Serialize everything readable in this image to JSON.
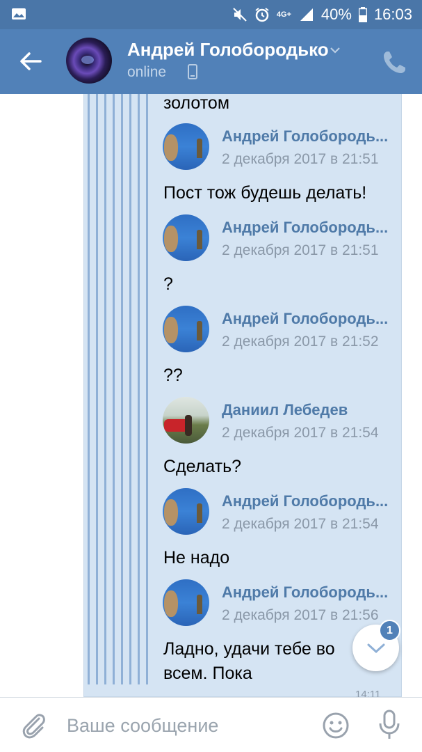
{
  "status_bar": {
    "network": "4G+",
    "battery": "40%",
    "time": "16:03",
    "icons": [
      "image-icon",
      "mute-icon",
      "alarm-icon",
      "network-icon",
      "signal-icon",
      "battery-icon"
    ]
  },
  "header": {
    "title": "Андрей Голобородько",
    "status": "online",
    "icons": [
      "back-arrow-icon",
      "chevron-down-icon",
      "mobile-device-icon",
      "phone-icon"
    ]
  },
  "forwarded": {
    "top_text": "золотом",
    "messages": [
      {
        "sender": "Андрей Голобородь...",
        "date": "2 декабря 2017 в 21:51",
        "text": "Пост тож будешь делать!"
      },
      {
        "sender": "Андрей Голобородь...",
        "date": "2 декабря 2017 в 21:51",
        "text": "?"
      },
      {
        "sender": "Андрей Голобородь...",
        "date": "2 декабря 2017 в 21:52",
        "text": "??"
      },
      {
        "sender": "Даниил Лебедев",
        "date": "2 декабря 2017 в 21:54",
        "text": "Сделать?"
      },
      {
        "sender": "Андрей Голобородь...",
        "date": "2 декабря 2017 в 21:54",
        "text": "Не надо"
      },
      {
        "sender": "Андрей Голобородь...",
        "date": "2 декабря 2017 в 21:56",
        "text_line1": "Ладно, удачи тебе во",
        "text_line2": "всем. Пока"
      }
    ],
    "time": "14:11"
  },
  "scroll_button": {
    "badge": "1"
  },
  "composer": {
    "placeholder": "Ваше сообщение",
    "icons": [
      "paperclip-icon",
      "emoji-icon",
      "microphone-icon"
    ]
  },
  "colors": {
    "header": "#5181b8",
    "status_bar": "#4a76a8",
    "bubble": "#d5e4f3",
    "sender_name": "#4f7aa8",
    "quote_lines": "#8fb0d6"
  }
}
